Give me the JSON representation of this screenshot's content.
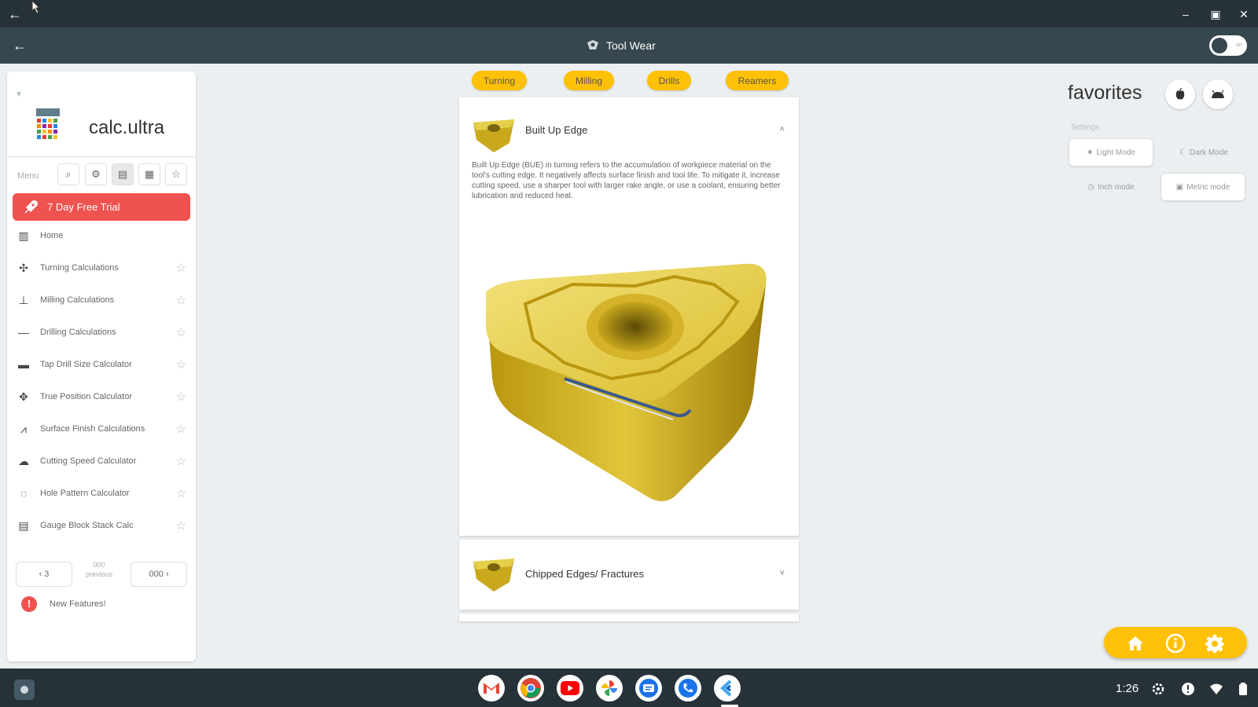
{
  "window": {
    "back_glyph": "←",
    "minimize_glyph": "–",
    "maximize_glyph": "▣",
    "close_glyph": "✕"
  },
  "appbar": {
    "title": "Tool Wear",
    "back_glyph": "←",
    "toggle_label": "on"
  },
  "sidebar": {
    "brand": "calc.ultra",
    "menu_label": "Menu",
    "trial_label": "7 Day Free Trial",
    "items": [
      {
        "label": "Home",
        "icon": "home-calculator-icon",
        "starred": false
      },
      {
        "label": "Turning Calculations",
        "icon": "turning-icon",
        "starred": true
      },
      {
        "label": "Milling Calculations",
        "icon": "milling-icon",
        "starred": true
      },
      {
        "label": "Drilling Calculations",
        "icon": "drilling-icon",
        "starred": true
      },
      {
        "label": "Tap Drill Size Calculator",
        "icon": "tap-drill-icon",
        "starred": true
      },
      {
        "label": "True Position Calculator",
        "icon": "true-position-icon",
        "starred": true
      },
      {
        "label": "Surface Finish Calculations",
        "icon": "surface-finish-icon",
        "starred": true
      },
      {
        "label": "Cutting Speed Calculator",
        "icon": "cutting-speed-icon",
        "starred": true
      },
      {
        "label": "Hole Pattern Calculator",
        "icon": "hole-pattern-icon",
        "starred": true
      },
      {
        "label": "Gauge Block Stack Calc",
        "icon": "gauge-block-icon",
        "starred": true
      }
    ],
    "pager": {
      "prev_label": "‹ 3",
      "center_top": "000",
      "center_bottom": "previous",
      "next_label": "000 ›"
    },
    "new_features_label": "New Features!",
    "new_features_alert": "!"
  },
  "categories": [
    "Turning",
    "Milling",
    "Drills",
    "Reamers"
  ],
  "cards": [
    {
      "title": "Built Up Edge",
      "expanded": true,
      "chevron": "˄",
      "description": "Built Up Edge (BUE) in turning refers to the accumulation of workpiece material on the tool's cutting edge. It negatively affects surface finish and tool life. To mitigate it, increase cutting speed, use a sharper tool with larger rake angle, or use a coolant, ensuring better lubrication and reduced heat."
    },
    {
      "title": "Chipped Edges/ Fractures",
      "expanded": false,
      "chevron": "˅"
    }
  ],
  "right_panel": {
    "favorites_title": "favorites",
    "settings_label": "Settings",
    "light_mode": "Light Mode",
    "dark_mode": "Dark Mode",
    "inch_mode": "Inch mode",
    "metric_mode": "Metric mode"
  },
  "shelf": {
    "time": "1:26",
    "apps": [
      "gmail-icon",
      "chrome-icon",
      "youtube-icon",
      "photos-icon",
      "messages-icon",
      "phone-icon",
      "calc-ultra-app-icon"
    ]
  },
  "colors": {
    "accent_yellow": "#ffc107",
    "trial_red": "#ef5350",
    "appbar": "#37474f",
    "titlebar": "#263238"
  }
}
